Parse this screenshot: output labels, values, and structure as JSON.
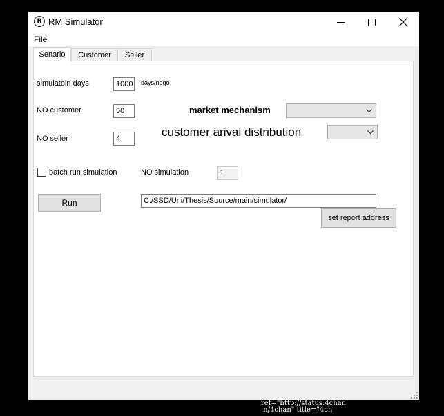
{
  "window": {
    "title": "RM Simulator"
  },
  "menu": {
    "file": "File"
  },
  "tabs": [
    {
      "label": "Senario",
      "active": true
    },
    {
      "label": "Customer",
      "active": false
    },
    {
      "label": "Seller",
      "active": false
    }
  ],
  "form": {
    "simulation_days_label": "simulatoin days",
    "simulation_days_value": "1000",
    "simulation_days_unit": "days/nego",
    "no_customer_label": "NO customer",
    "no_customer_value": "50",
    "no_seller_label": "NO seller",
    "no_seller_value": "4",
    "market_mechanism_label": "market mechanism",
    "market_mechanism_value": "",
    "arrival_distribution_label": "customer arival distribution",
    "arrival_distribution_value": "",
    "batch_run_label": "batch run simulation",
    "batch_run_checked": false,
    "no_simulation_label": "NO simulation",
    "no_simulation_value": "1",
    "run_label": "Run",
    "report_path": "C:/SSD/Uni/Thesis/Source/main/simulator/",
    "set_report_label": "set report address"
  },
  "overlay": {
    "text": "ref=\"http://status.4chan\n n/4chan\" title=\"4ch"
  },
  "icons": {
    "app": "rm-simulator-app-icon",
    "minimize": "minimize-icon",
    "maximize": "maximize-icon",
    "close": "close-icon",
    "dropdown": "chevron-down-icon",
    "grip": "resize-grip-icon"
  }
}
